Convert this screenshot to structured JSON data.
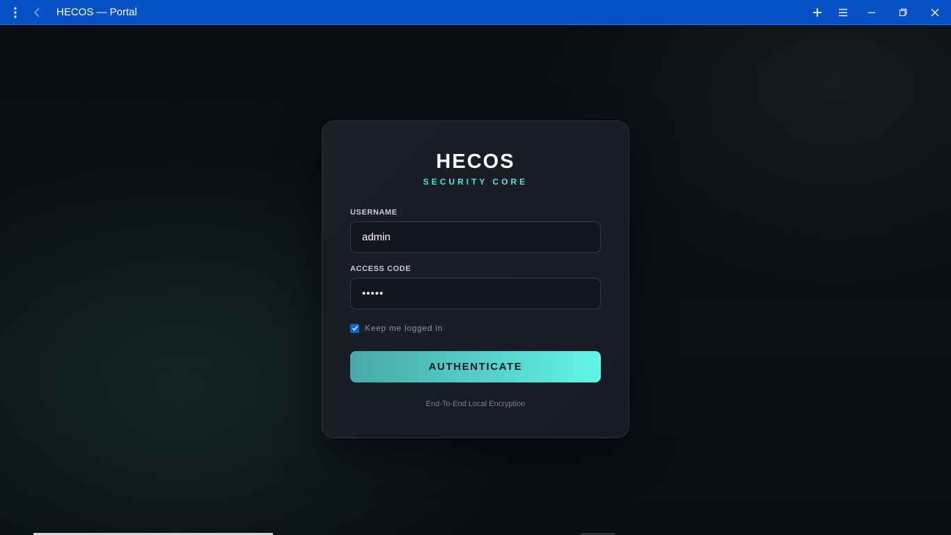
{
  "window": {
    "title": "HECOS — Portal"
  },
  "login": {
    "brand": "HECOS",
    "tagline": "SECURITY CORE",
    "username_label": "USERNAME",
    "username_value": "admin",
    "access_code_label": "ACCESS CODE",
    "access_code_value": "•••••",
    "remember_label": "Keep me logged in",
    "remember_checked": true,
    "submit_label": "AUTHENTICATE",
    "footer": "End-To-End Local Encryption"
  },
  "colors": {
    "titlebar": "#0751c4",
    "accent": "#4fe3d8",
    "checkbox": "#0b63d8"
  },
  "icons": {
    "menu": "kebab-menu-icon",
    "back": "chevron-left-icon",
    "new": "plus-icon",
    "options": "hamburger-icon",
    "minimize": "minimize-icon",
    "maximize": "restore-icon",
    "close": "close-icon"
  }
}
